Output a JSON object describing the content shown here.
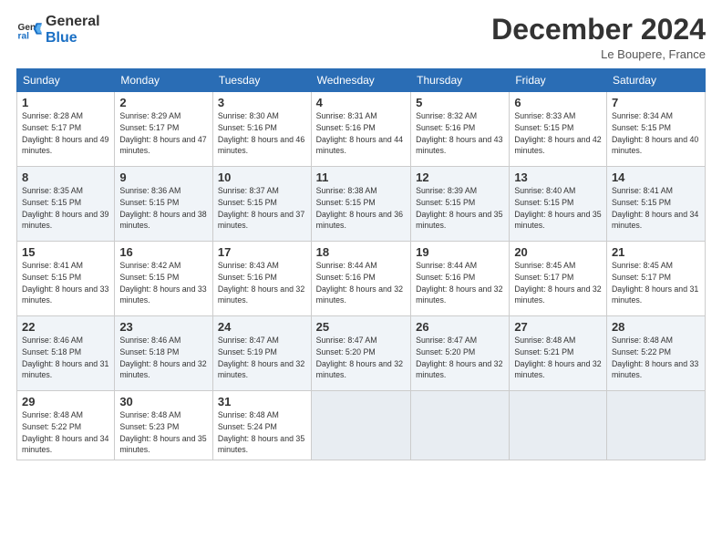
{
  "header": {
    "logo_line1": "General",
    "logo_line2": "Blue",
    "month_title": "December 2024",
    "location": "Le Boupere, France"
  },
  "days_of_week": [
    "Sunday",
    "Monday",
    "Tuesday",
    "Wednesday",
    "Thursday",
    "Friday",
    "Saturday"
  ],
  "weeks": [
    [
      {
        "day": 1,
        "sunrise": "8:28 AM",
        "sunset": "5:17 PM",
        "daylight": "8 hours and 49 minutes."
      },
      {
        "day": 2,
        "sunrise": "8:29 AM",
        "sunset": "5:17 PM",
        "daylight": "8 hours and 47 minutes."
      },
      {
        "day": 3,
        "sunrise": "8:30 AM",
        "sunset": "5:16 PM",
        "daylight": "8 hours and 46 minutes."
      },
      {
        "day": 4,
        "sunrise": "8:31 AM",
        "sunset": "5:16 PM",
        "daylight": "8 hours and 44 minutes."
      },
      {
        "day": 5,
        "sunrise": "8:32 AM",
        "sunset": "5:16 PM",
        "daylight": "8 hours and 43 minutes."
      },
      {
        "day": 6,
        "sunrise": "8:33 AM",
        "sunset": "5:15 PM",
        "daylight": "8 hours and 42 minutes."
      },
      {
        "day": 7,
        "sunrise": "8:34 AM",
        "sunset": "5:15 PM",
        "daylight": "8 hours and 40 minutes."
      }
    ],
    [
      {
        "day": 8,
        "sunrise": "8:35 AM",
        "sunset": "5:15 PM",
        "daylight": "8 hours and 39 minutes."
      },
      {
        "day": 9,
        "sunrise": "8:36 AM",
        "sunset": "5:15 PM",
        "daylight": "8 hours and 38 minutes."
      },
      {
        "day": 10,
        "sunrise": "8:37 AM",
        "sunset": "5:15 PM",
        "daylight": "8 hours and 37 minutes."
      },
      {
        "day": 11,
        "sunrise": "8:38 AM",
        "sunset": "5:15 PM",
        "daylight": "8 hours and 36 minutes."
      },
      {
        "day": 12,
        "sunrise": "8:39 AM",
        "sunset": "5:15 PM",
        "daylight": "8 hours and 35 minutes."
      },
      {
        "day": 13,
        "sunrise": "8:40 AM",
        "sunset": "5:15 PM",
        "daylight": "8 hours and 35 minutes."
      },
      {
        "day": 14,
        "sunrise": "8:41 AM",
        "sunset": "5:15 PM",
        "daylight": "8 hours and 34 minutes."
      }
    ],
    [
      {
        "day": 15,
        "sunrise": "8:41 AM",
        "sunset": "5:15 PM",
        "daylight": "8 hours and 33 minutes."
      },
      {
        "day": 16,
        "sunrise": "8:42 AM",
        "sunset": "5:15 PM",
        "daylight": "8 hours and 33 minutes."
      },
      {
        "day": 17,
        "sunrise": "8:43 AM",
        "sunset": "5:16 PM",
        "daylight": "8 hours and 32 minutes."
      },
      {
        "day": 18,
        "sunrise": "8:44 AM",
        "sunset": "5:16 PM",
        "daylight": "8 hours and 32 minutes."
      },
      {
        "day": 19,
        "sunrise": "8:44 AM",
        "sunset": "5:16 PM",
        "daylight": "8 hours and 32 minutes."
      },
      {
        "day": 20,
        "sunrise": "8:45 AM",
        "sunset": "5:17 PM",
        "daylight": "8 hours and 32 minutes."
      },
      {
        "day": 21,
        "sunrise": "8:45 AM",
        "sunset": "5:17 PM",
        "daylight": "8 hours and 31 minutes."
      }
    ],
    [
      {
        "day": 22,
        "sunrise": "8:46 AM",
        "sunset": "5:18 PM",
        "daylight": "8 hours and 31 minutes."
      },
      {
        "day": 23,
        "sunrise": "8:46 AM",
        "sunset": "5:18 PM",
        "daylight": "8 hours and 32 minutes."
      },
      {
        "day": 24,
        "sunrise": "8:47 AM",
        "sunset": "5:19 PM",
        "daylight": "8 hours and 32 minutes."
      },
      {
        "day": 25,
        "sunrise": "8:47 AM",
        "sunset": "5:20 PM",
        "daylight": "8 hours and 32 minutes."
      },
      {
        "day": 26,
        "sunrise": "8:47 AM",
        "sunset": "5:20 PM",
        "daylight": "8 hours and 32 minutes."
      },
      {
        "day": 27,
        "sunrise": "8:48 AM",
        "sunset": "5:21 PM",
        "daylight": "8 hours and 32 minutes."
      },
      {
        "day": 28,
        "sunrise": "8:48 AM",
        "sunset": "5:22 PM",
        "daylight": "8 hours and 33 minutes."
      }
    ],
    [
      {
        "day": 29,
        "sunrise": "8:48 AM",
        "sunset": "5:22 PM",
        "daylight": "8 hours and 34 minutes."
      },
      {
        "day": 30,
        "sunrise": "8:48 AM",
        "sunset": "5:23 PM",
        "daylight": "8 hours and 35 minutes."
      },
      {
        "day": 31,
        "sunrise": "8:48 AM",
        "sunset": "5:24 PM",
        "daylight": "8 hours and 35 minutes."
      },
      null,
      null,
      null,
      null
    ]
  ]
}
